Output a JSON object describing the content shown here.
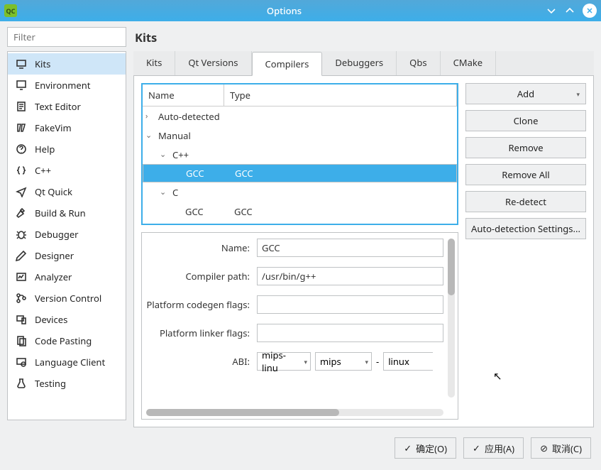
{
  "window": {
    "title": "Options",
    "logo": "QC"
  },
  "filter": {
    "placeholder": "Filter"
  },
  "heading": "Kits",
  "sidebar": {
    "items": [
      {
        "label": "Kits",
        "selected": true,
        "icon": "kits"
      },
      {
        "label": "Environment",
        "icon": "monitor"
      },
      {
        "label": "Text Editor",
        "icon": "doc"
      },
      {
        "label": "FakeVim",
        "icon": "vim"
      },
      {
        "label": "Help",
        "icon": "help"
      },
      {
        "label": "C++",
        "icon": "braces"
      },
      {
        "label": "Qt Quick",
        "icon": "plane"
      },
      {
        "label": "Build & Run",
        "icon": "hammer"
      },
      {
        "label": "Debugger",
        "icon": "bug"
      },
      {
        "label": "Designer",
        "icon": "pencil"
      },
      {
        "label": "Analyzer",
        "icon": "analyzer"
      },
      {
        "label": "Version Control",
        "icon": "vcs"
      },
      {
        "label": "Devices",
        "icon": "devices"
      },
      {
        "label": "Code Pasting",
        "icon": "paste"
      },
      {
        "label": "Language Client",
        "icon": "lsp"
      },
      {
        "label": "Testing",
        "icon": "test"
      }
    ]
  },
  "tabs": [
    {
      "label": "Kits"
    },
    {
      "label": "Qt Versions"
    },
    {
      "label": "Compilers",
      "active": true
    },
    {
      "label": "Debuggers"
    },
    {
      "label": "Qbs"
    },
    {
      "label": "CMake"
    }
  ],
  "tree": {
    "headers": {
      "name": "Name",
      "type": "Type"
    },
    "nodes": {
      "auto": "Auto-detected",
      "manual": "Manual",
      "cpp": "C++",
      "cpp_gcc_name": "GCC",
      "cpp_gcc_type": "GCC",
      "c": "C",
      "c_gcc_name": "GCC",
      "c_gcc_type": "GCC"
    }
  },
  "details": {
    "labels": {
      "name": "Name:",
      "compiler_path": "Compiler path:",
      "codegen": "Platform codegen flags:",
      "linker": "Platform linker flags:",
      "abi": "ABI:"
    },
    "values": {
      "name": "GCC",
      "compiler_path": "/usr/bin/g++",
      "codegen": "",
      "linker": "",
      "abi1": "mips-linu",
      "abi2": "mips",
      "abi_dash": "-",
      "abi3": "linux"
    }
  },
  "buttons": {
    "add": "Add",
    "clone": "Clone",
    "remove": "Remove",
    "remove_all": "Remove All",
    "redetect": "Re-detect",
    "auto_settings": "Auto-detection Settings..."
  },
  "dialog_buttons": {
    "ok": "确定(O)",
    "apply": "应用(A)",
    "cancel": "取消(C)"
  }
}
